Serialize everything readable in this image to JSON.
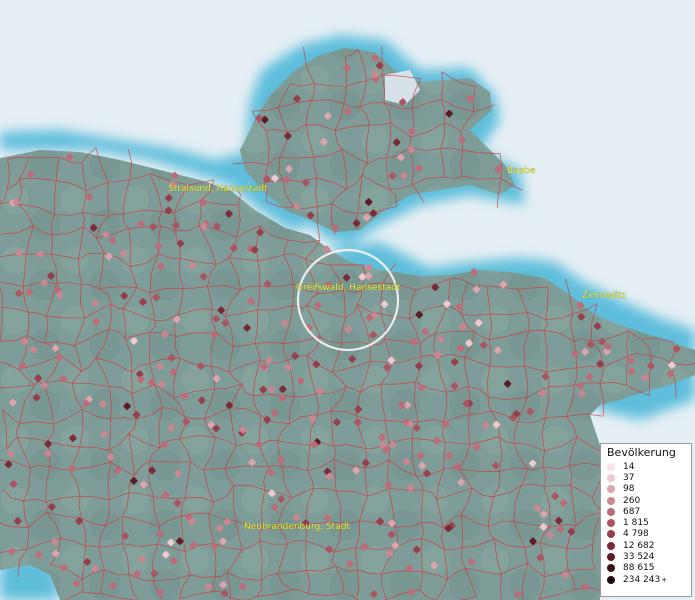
{
  "map": {
    "cities": [
      {
        "name": "Stralsund, Hansestadt"
      },
      {
        "name": "Baabe"
      },
      {
        "name": "Greifswald, Hansestadt"
      },
      {
        "name": "Zinnowitz"
      },
      {
        "name": "Neubrandenburg, Stadt"
      }
    ]
  },
  "legend": {
    "title": "Bevölkerung",
    "items": [
      {
        "value": "14",
        "color": "#f7e3e8"
      },
      {
        "value": "37",
        "color": "#eec9d0"
      },
      {
        "value": "98",
        "color": "#dca4ae"
      },
      {
        "value": "260",
        "color": "#cd8792"
      },
      {
        "value": "687",
        "color": "#bd6b78"
      },
      {
        "value": "1 815",
        "color": "#ab5462"
      },
      {
        "value": "4 798",
        "color": "#963e4c"
      },
      {
        "value": "12 682",
        "color": "#7a2b37"
      },
      {
        "value": "33 524",
        "color": "#5c1d26"
      },
      {
        "value": "88 615",
        "color": "#3e1118"
      },
      {
        "value": "234 243",
        "color": "#1f070b",
        "suffix": "+"
      }
    ]
  }
}
